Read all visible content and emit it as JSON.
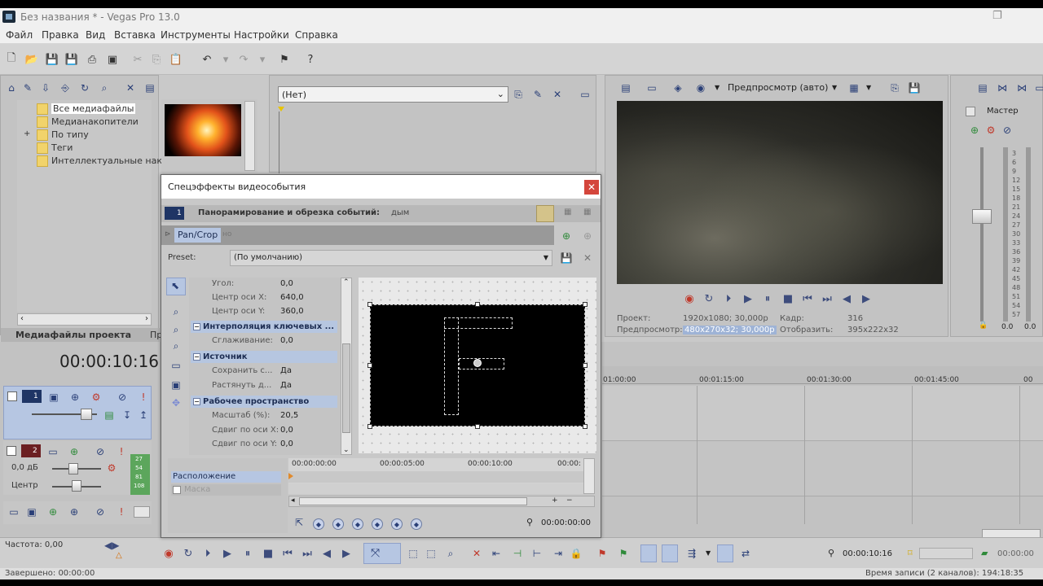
{
  "window": {
    "title": "Без названия * - Vegas Pro 13.0"
  },
  "menu": [
    "Файл",
    "Правка",
    "Вид",
    "Вставка",
    "Инструменты",
    "Настройки",
    "Справка"
  ],
  "explorer": {
    "tree": [
      "Все медиафайлы",
      "Медианакопители",
      "По типу",
      "Теги",
      "Интеллектуальные нак"
    ],
    "tab_label": "Медиафайлы проекта",
    "tab_next": "Пр"
  },
  "trimmer": {
    "dropdown_value": "(Нет)"
  },
  "preview": {
    "mode_label": "Предпросмотр (авто)",
    "project_label": "Проект:",
    "project_value": "1920x1080; 30,000p",
    "preview_label": "Предпросмотр:",
    "preview_value": "480x270x32; 30,000p",
    "frame_label": "Кадр:",
    "frame_value": "316",
    "display_label": "Отобразить:",
    "display_value": "395x222x32"
  },
  "master": {
    "label": "Мастер",
    "scale": [
      "3",
      "6",
      "9",
      "12",
      "15",
      "18",
      "21",
      "24",
      "27",
      "30",
      "33",
      "36",
      "39",
      "42",
      "45",
      "48",
      "51",
      "54",
      "57"
    ],
    "value_left": "0.0",
    "value_right": "0.0"
  },
  "timeline": {
    "time_code": "00:00:10:16",
    "ruler": [
      "01:00:00",
      "00:01:15:00",
      "00:01:30:00",
      "00:01:45:00",
      "00"
    ]
  },
  "track2": {
    "volume": "0,0 дБ",
    "pan": "Центр",
    "meter": [
      "27",
      "54",
      "81",
      "108"
    ]
  },
  "transport": {
    "rate_label": "Частота: 0,00",
    "time_right": "00:00:10:16",
    "time_far_right": "00:00:00"
  },
  "status": {
    "left": "Завершено: 00:00:00",
    "right": "Время записи (2 каналов): 194:18:35"
  },
  "dialog": {
    "title": "Спецэффекты видеособытия",
    "chain_title": "Панорамирование и обрезка событий:",
    "chain_event": "дым",
    "plugin_tab": "Pan/Crop",
    "plugin_tab_suffix": "но",
    "preset_label": "Preset:",
    "preset_value": "(По умолчанию)",
    "props": {
      "angle_label": "Угол:",
      "angle_value": "0,0",
      "center_x_label": "Центр оси X:",
      "center_x_value": "640,0",
      "center_y_label": "Центр оси Y:",
      "center_y_value": "360,0",
      "interp_head": "Интерполяция ключевых ...",
      "smoothing_label": "Сглаживание:",
      "smoothing_value": "0,0",
      "source_head": "Источник",
      "keep_label": "Сохранить с...",
      "keep_value": "Да",
      "stretch_label": "Растянуть д...",
      "stretch_value": "Да",
      "workspace_head": "Рабочее пространство",
      "scale_label": "Масштаб (%):",
      "scale_value": "20,5",
      "shift_x_label": "Сдвиг по оси X:",
      "shift_x_value": "0,0",
      "shift_y_label": "Сдвиг по оси Y:",
      "shift_y_value": "0,0"
    },
    "kf_ruler": [
      "00:00:00:00",
      "00:00:05:00",
      "00:00:10:00",
      "00:00:"
    ],
    "kf_rows": [
      "Расположение",
      "Маска"
    ],
    "kf_time": "00:00:00:00"
  }
}
